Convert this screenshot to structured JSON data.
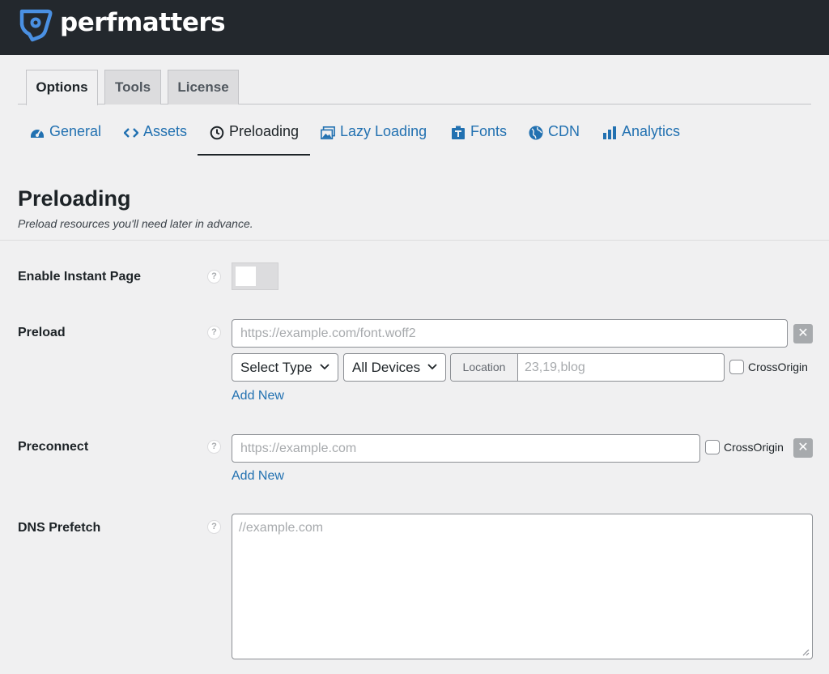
{
  "brand": {
    "name": "perfmatters",
    "bar_color": "#23282d",
    "logo_color": "#4a90e2"
  },
  "tabs": [
    {
      "label": "Options",
      "active": true
    },
    {
      "label": "Tools",
      "active": false
    },
    {
      "label": "License",
      "active": false
    }
  ],
  "subnav": [
    {
      "label": "General",
      "icon": "dashboard-icon",
      "active": false
    },
    {
      "label": "Assets",
      "icon": "code-icon",
      "active": false
    },
    {
      "label": "Preloading",
      "icon": "clock-icon",
      "active": true
    },
    {
      "label": "Lazy Loading",
      "icon": "images-icon",
      "active": false
    },
    {
      "label": "Fonts",
      "icon": "fonts-icon",
      "active": false
    },
    {
      "label": "CDN",
      "icon": "globe-icon",
      "active": false
    },
    {
      "label": "Analytics",
      "icon": "chart-icon",
      "active": false
    }
  ],
  "section": {
    "title": "Preloading",
    "description": "Preload resources you'll need later in advance."
  },
  "help_symbol": "?",
  "remove_symbol": "✕",
  "fields": {
    "instant_page": {
      "label": "Enable Instant Page",
      "enabled": false
    },
    "preload": {
      "label": "Preload",
      "placeholder": "https://example.com/font.woff2",
      "type_select": "Select Type",
      "device_select": "All Devices",
      "location_prefix": "Location",
      "location_placeholder": "23,19,blog",
      "crossorigin_label": "CrossOrigin",
      "add_new": "Add New"
    },
    "preconnect": {
      "label": "Preconnect",
      "placeholder": "https://example.com",
      "crossorigin_label": "CrossOrigin",
      "add_new": "Add New"
    },
    "dns_prefetch": {
      "label": "DNS Prefetch",
      "placeholder": "//example.com"
    }
  }
}
